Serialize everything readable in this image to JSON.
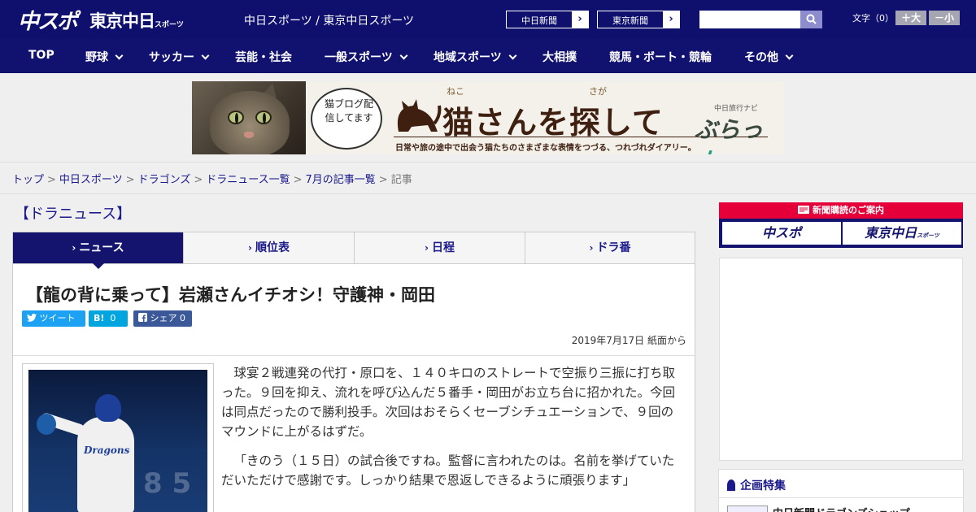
{
  "header": {
    "logo_main": "中スポ",
    "logo_sub": "東京中日",
    "logo_sub_small": "スポーツ",
    "subtitle": "中日スポーツ / 東京中日スポーツ",
    "news_links": [
      {
        "label": "中日新聞",
        "arrow": "›"
      },
      {
        "label": "東京新聞",
        "arrow": "›"
      }
    ],
    "search": {
      "placeholder": "",
      "value": ""
    },
    "font_size_label": "文字（0）",
    "font_bigger": "＋大",
    "font_smaller": "－小"
  },
  "nav": {
    "items": [
      {
        "label": "TOP",
        "has_dropdown": false
      },
      {
        "label": "野球",
        "has_dropdown": true
      },
      {
        "label": "サッカー",
        "has_dropdown": true
      },
      {
        "label": "芸能・社会",
        "has_dropdown": false
      },
      {
        "label": "一般スポーツ",
        "has_dropdown": true
      },
      {
        "label": "地域スポーツ",
        "has_dropdown": true
      },
      {
        "label": "大相撲",
        "has_dropdown": false
      },
      {
        "label": "競馬・ボート・競輪",
        "has_dropdown": false
      },
      {
        "label": "その他",
        "has_dropdown": true
      }
    ]
  },
  "banner": {
    "bubble_text": "猫ブログ配信してます",
    "ruby_neko": "ねこ",
    "ruby_saga": "さが",
    "title": "猫さんを探して",
    "subtitle": "日常や旅の途中で出会う猫たちのさまざまな表情をつづる、つれづれダイアリー。",
    "brand_small": "中日旅行ナビ",
    "brand_main": "ぶらっ",
    "brand_accent": "人"
  },
  "breadcrumb": {
    "items": [
      "トップ",
      "中日スポーツ",
      "ドラゴンズ",
      "ドラニュース一覧",
      "7月の記事一覧"
    ],
    "separator": ">",
    "current": "記事"
  },
  "section_heading": "【ドラニュース】",
  "tabs": [
    {
      "label": "ニュース",
      "active": true
    },
    {
      "label": "順位表",
      "active": false
    },
    {
      "label": "日程",
      "active": false
    },
    {
      "label": "ドラ番",
      "active": false
    }
  ],
  "tab_chevron": "›",
  "article": {
    "title": "【龍の背に乗って】岩瀬さんイチオシ！守護神・岡田",
    "share": {
      "tweet_label": "ツイート",
      "hatena_label": "B!",
      "hatena_count": "0",
      "fb_label": "シェア",
      "fb_count": "0"
    },
    "date": "2019年7月17日 紙面から",
    "photo_caption_mark": "Dragons",
    "paragraphs": [
      "球宴２戦連発の代打・原口を、１４０キロのストレートで空振り三振に打ち取った。９回を抑え、流れを呼び込んだ５番手・岡田がお立ち台に招かれた。今回は同点だったので勝利投手。次回はおそらくセーブシチュエーションで、９回のマウンドに上がるはずだ。",
      "「きのう（１５日）の試合後ですね。監督に言われたのは。名前を挙げていただいただけで感謝です。しっかり結果で恩返しできるように頑張ります」"
    ]
  },
  "sidebar": {
    "subscribe_label": "新聞購読のご案内",
    "subscribe_btn1": "中スポ",
    "subscribe_btn2": "東京中日",
    "subscribe_btn2_small": "スポーツ",
    "feature_heading": "企画特集",
    "feature_item": "中日新聞ドラゴンズショップ"
  },
  "colors": {
    "header_bg": "#0f0f6e",
    "nav_bg": "#111170",
    "accent_red": "#e60039",
    "link": "#1a1a8c",
    "twitter": "#1da1f2",
    "hatena": "#00a4de",
    "facebook": "#3b5998"
  },
  "icons": [
    "search-icon",
    "twitter-icon",
    "hatena-icon",
    "facebook-icon",
    "chevron-down-icon",
    "chevron-right-icon",
    "ribbon-icon",
    "newspaper-icon"
  ]
}
